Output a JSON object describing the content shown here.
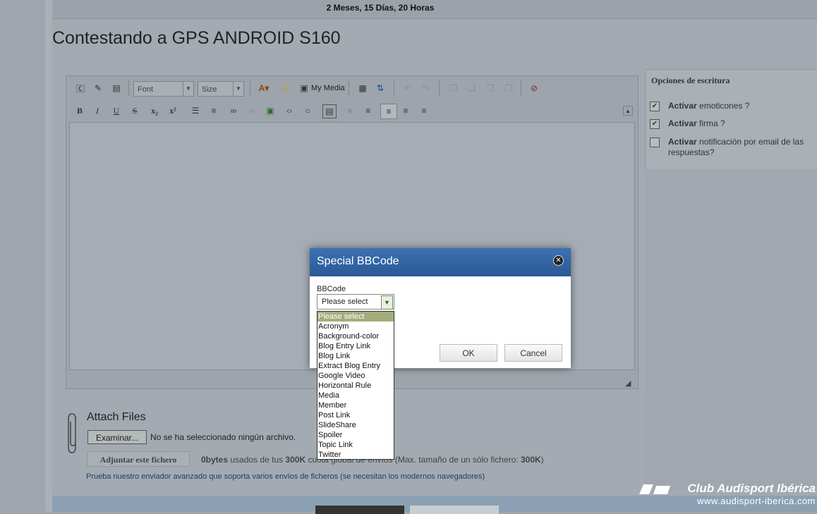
{
  "top_info": "2 Meses, 15 Días, 20 Horas",
  "page_title": "Contestando a GPS ANDROID S160",
  "editor": {
    "font_placeholder": "Font",
    "size_placeholder": "Size",
    "my_media_label": "My Media"
  },
  "side_panel": {
    "title": "Opciones de escritura",
    "options": [
      {
        "bold": "Activar",
        "rest": " emoticones ?",
        "checked": true
      },
      {
        "bold": "Activar",
        "rest": " firma ?",
        "checked": true
      },
      {
        "bold": "Activar",
        "rest": " notificación por email de las respuestas?",
        "checked": false
      }
    ]
  },
  "attach": {
    "title": "Attach Files",
    "browse_label": "Examinar...",
    "no_file_text": "No se ha seleccionado ningún archivo.",
    "upload_label": "Adjuntar este fichero",
    "quota_bytes": "0bytes",
    "quota_text_1": " usados de tus ",
    "quota_total": "300K",
    "quota_text_2": " cuota global de envíos (Max. tamaño de un sólo fichero: ",
    "quota_single": "300K",
    "quota_text_3": ")",
    "advanced_link": "Prueba nuestro enviador avanzado que soporta varios envíos de ficheros (se necesitan los modernos navegadores)"
  },
  "dialog": {
    "title": "Special BBCode",
    "field_label": "BBCode",
    "selected_value": "Please select",
    "ok_label": "OK",
    "cancel_label": "Cancel",
    "options": [
      "Please select",
      "Acronym",
      "Background-color",
      "Blog Entry Link",
      "Blog Link",
      "Extract Blog Entry",
      "Google Video",
      "Horizontal Rule",
      "Media",
      "Member",
      "Post Link",
      "SlideShare",
      "Spoiler",
      "Topic Link",
      "Twitter"
    ]
  },
  "brand": {
    "name": "Club Audisport Ibérica",
    "url": "www.audisport-iberica.com"
  }
}
